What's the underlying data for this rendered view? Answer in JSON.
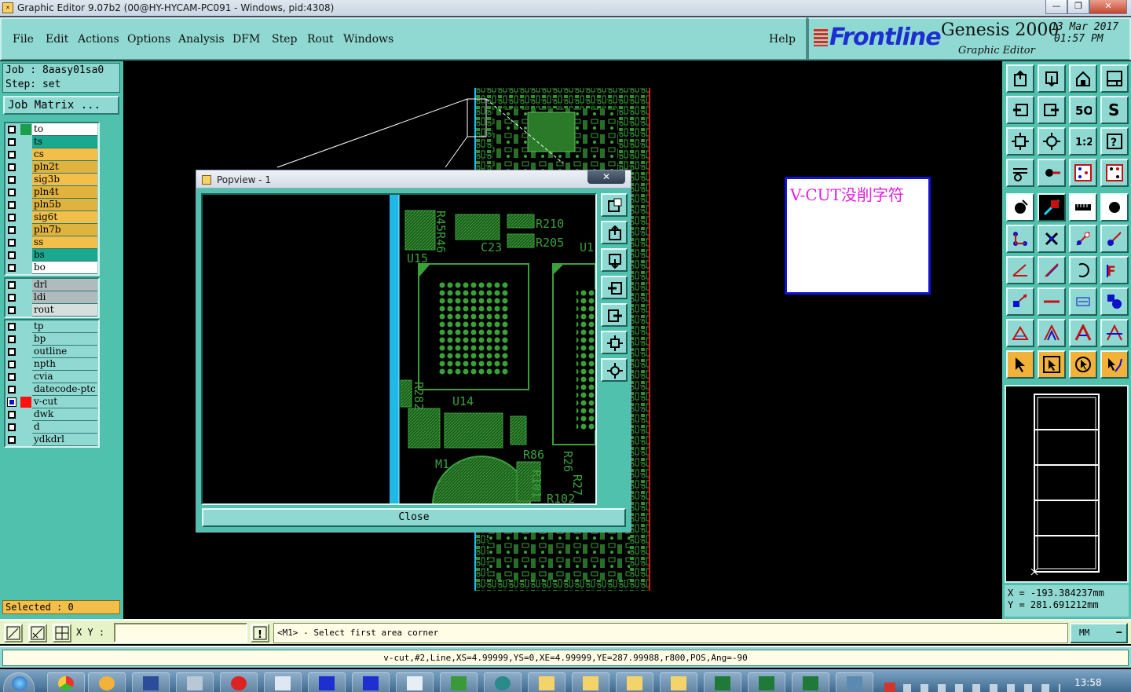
{
  "window": {
    "title": "Graphic Editor 9.07b2 (00@HY-HYCAM-PC091 - Windows, pid:4308)"
  },
  "menu": {
    "items": [
      "File",
      "Edit",
      "Actions",
      "Options",
      "Analysis",
      "DFM",
      "Step",
      "Rout",
      "Windows"
    ],
    "help": "Help"
  },
  "brand": {
    "logo": "Frontline",
    "product": "Genesis 2000",
    "subtitle": "Graphic Editor",
    "date": "13 Mar 2017",
    "time": "01:57 PM"
  },
  "job": {
    "job_label": "Job : 8aasy01sa0",
    "step_label": "Step: set",
    "matrix_button": "Job Matrix ..."
  },
  "layers": {
    "group1": [
      {
        "name": "to",
        "color": "#ffffff",
        "swatch": "#1a9e4a"
      },
      {
        "name": "ts",
        "color": "#1aa88f",
        "swatch": "#8fd9d2"
      },
      {
        "name": "cs",
        "color": "#f2c04a",
        "swatch": "#8fd9d2"
      },
      {
        "name": "pln2t",
        "color": "#e0b23e",
        "swatch": "#8fd9d2"
      },
      {
        "name": "sig3b",
        "color": "#f2c04a",
        "swatch": "#8fd9d2"
      },
      {
        "name": "pln4t",
        "color": "#e0b23e",
        "swatch": "#8fd9d2"
      },
      {
        "name": "pln5b",
        "color": "#e0b23e",
        "swatch": "#8fd9d2"
      },
      {
        "name": "sig6t",
        "color": "#f2c04a",
        "swatch": "#8fd9d2"
      },
      {
        "name": "pln7b",
        "color": "#e0b23e",
        "swatch": "#8fd9d2"
      },
      {
        "name": "ss",
        "color": "#f2c04a",
        "swatch": "#8fd9d2"
      },
      {
        "name": "bs",
        "color": "#1aa88f",
        "swatch": "#8fd9d2"
      },
      {
        "name": "bo",
        "color": "#ffffff",
        "swatch": "#8fd9d2"
      }
    ],
    "group2": [
      {
        "name": "drl",
        "color": "#b0bcbc",
        "swatch": "#8fd9d2"
      },
      {
        "name": "ldi",
        "color": "#b0bcbc",
        "swatch": "#8fd9d2"
      },
      {
        "name": "rout",
        "color": "#d6dede",
        "swatch": "#8fd9d2"
      }
    ],
    "group3": [
      {
        "name": "tp",
        "color": "#8fd9d2",
        "swatch": "#8fd9d2"
      },
      {
        "name": "bp",
        "color": "#8fd9d2",
        "swatch": "#8fd9d2"
      },
      {
        "name": "outline",
        "color": "#8fd9d2",
        "swatch": "#8fd9d2"
      },
      {
        "name": "npth",
        "color": "#8fd9d2",
        "swatch": "#8fd9d2"
      },
      {
        "name": "cvia",
        "color": "#8fd9d2",
        "swatch": "#8fd9d2"
      },
      {
        "name": "datecode-ptc",
        "color": "#8fd9d2",
        "swatch": "#8fd9d2"
      },
      {
        "name": "v-cut",
        "color": "#8fd9d2",
        "swatch": "#ff1010",
        "active": true
      },
      {
        "name": "dwk",
        "color": "#8fd9d2",
        "swatch": "#8fd9d2"
      },
      {
        "name": "d",
        "color": "#8fd9d2",
        "swatch": "#8fd9d2"
      },
      {
        "name": "ydkdrl",
        "color": "#8fd9d2",
        "swatch": "#8fd9d2"
      }
    ]
  },
  "selected": "Selected : 0",
  "popup": {
    "title": "Popview - 1",
    "close_x": "✕",
    "close_button": "Close",
    "labels": [
      "R210",
      "R205",
      "C23",
      "U15",
      "U14",
      "R86",
      "R101",
      "R102",
      "R282",
      "R26",
      "R27",
      "M1",
      "R45R46",
      "U1"
    ]
  },
  "note": {
    "text": "V-CUT没削字符"
  },
  "coords": {
    "x": "X = -193.384237mm",
    "y": "Y = 281.691212mm"
  },
  "bottom": {
    "xy_label": "X Y :",
    "xy_value": "",
    "prompt": "<M1> - Select first area corner",
    "units": "MM"
  },
  "info": {
    "text": "v-cut,#2,Line,XS=4.99999,YS=0,XE=4.99999,YE=287.99988,r800,POS,Ang=-90"
  },
  "taskbar": {
    "clock": "13:58"
  },
  "colors": {
    "panel": "#8fd9d2",
    "panel_dark": "#4fc1ad",
    "pcb_green": "#3aa03a",
    "accent_red": "#e12a1a"
  }
}
